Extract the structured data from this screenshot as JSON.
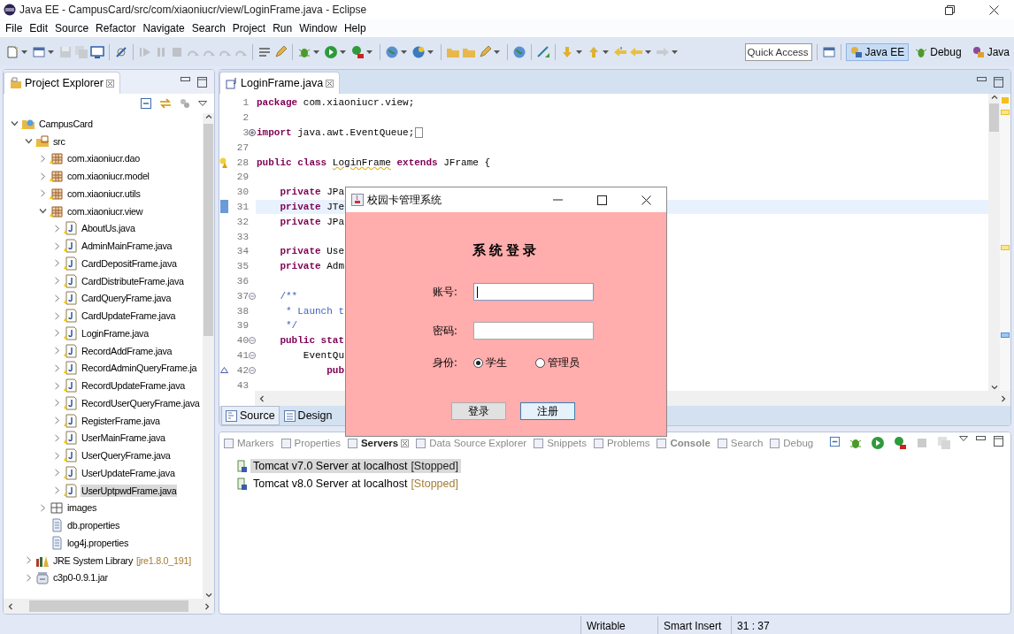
{
  "window": {
    "title": "Java EE - CampusCard/src/com/xiaoniucr/view/LoginFrame.java - Eclipse"
  },
  "menu": [
    "File",
    "Edit",
    "Source",
    "Refactor",
    "Navigate",
    "Search",
    "Project",
    "Run",
    "Window",
    "Help"
  ],
  "quick_access": {
    "placeholder": "Quick Access"
  },
  "perspectives": [
    {
      "label": "Java EE",
      "selected": true
    },
    {
      "label": "Debug",
      "selected": false
    },
    {
      "label": "Java",
      "selected": false
    }
  ],
  "explorer": {
    "title": "Project Explorer",
    "tree": [
      {
        "label": "CampusCard",
        "kind": "project",
        "expanded": true,
        "selected": false,
        "children": [
          {
            "label": "src",
            "kind": "source-folder",
            "expanded": true,
            "selected": false,
            "children": [
              {
                "label": "com.xiaoniucr.dao",
                "kind": "package",
                "expanded": false,
                "selected": false
              },
              {
                "label": "com.xiaoniucr.model",
                "kind": "package",
                "expanded": false,
                "selected": false
              },
              {
                "label": "com.xiaoniucr.utils",
                "kind": "package",
                "expanded": false,
                "selected": false
              },
              {
                "label": "com.xiaoniucr.view",
                "kind": "package",
                "expanded": true,
                "selected": false,
                "children": [
                  {
                    "label": "AboutUs.java",
                    "kind": "java-file",
                    "expanded": false,
                    "selected": false
                  },
                  {
                    "label": "AdminMainFrame.java",
                    "kind": "java-file",
                    "expanded": false,
                    "selected": false
                  },
                  {
                    "label": "CardDepositFrame.java",
                    "kind": "java-file",
                    "expanded": false,
                    "selected": false
                  },
                  {
                    "label": "CardDistributeFrame.java",
                    "kind": "java-file",
                    "expanded": false,
                    "selected": false
                  },
                  {
                    "label": "CardQueryFrame.java",
                    "kind": "java-file",
                    "expanded": false,
                    "selected": false
                  },
                  {
                    "label": "CardUpdateFrame.java",
                    "kind": "java-file",
                    "expanded": false,
                    "selected": false
                  },
                  {
                    "label": "LoginFrame.java",
                    "kind": "java-file",
                    "expanded": false,
                    "selected": false
                  },
                  {
                    "label": "RecordAddFrame.java",
                    "kind": "java-file",
                    "expanded": false,
                    "selected": false
                  },
                  {
                    "label": "RecordAdminQueryFrame.ja",
                    "kind": "java-file",
                    "expanded": false,
                    "selected": false
                  },
                  {
                    "label": "RecordUpdateFrame.java",
                    "kind": "java-file",
                    "expanded": false,
                    "selected": false
                  },
                  {
                    "label": "RecordUserQueryFrame.java",
                    "kind": "java-file",
                    "expanded": false,
                    "selected": false
                  },
                  {
                    "label": "RegisterFrame.java",
                    "kind": "java-file",
                    "expanded": false,
                    "selected": false
                  },
                  {
                    "label": "UserMainFrame.java",
                    "kind": "java-file",
                    "expanded": false,
                    "selected": false
                  },
                  {
                    "label": "UserQueryFrame.java",
                    "kind": "java-file",
                    "expanded": false,
                    "selected": false
                  },
                  {
                    "label": "UserUpdateFrame.java",
                    "kind": "java-file",
                    "expanded": false,
                    "selected": false
                  },
                  {
                    "label": "UserUptpwdFrame.java",
                    "kind": "java-file",
                    "expanded": false,
                    "selected": true
                  }
                ]
              },
              {
                "label": "images",
                "kind": "folder",
                "expanded": false,
                "selected": false
              },
              {
                "label": "db.properties",
                "kind": "file",
                "selected": false
              },
              {
                "label": "log4j.properties",
                "kind": "file",
                "selected": false
              }
            ]
          },
          {
            "label": "JRE System Library",
            "decoration": "[jre1.8.0_191]",
            "kind": "library",
            "expanded": false,
            "selected": false
          },
          {
            "label": "c3p0-0.9.1.jar",
            "kind": "jar",
            "expanded": false,
            "selected": false
          }
        ]
      }
    ]
  },
  "editor": {
    "tabs": [
      {
        "label": "LoginFrame.java",
        "selected": true
      }
    ],
    "lines": [
      {
        "number": "1",
        "segments": [
          {
            "text": "package",
            "kind": "kw"
          },
          {
            "text": " com.xiaoniucr.view;",
            "kind": "plain"
          }
        ]
      },
      {
        "number": "2"
      },
      {
        "number": "3",
        "foldable": true,
        "collapsed": true,
        "segments": [
          {
            "text": "import",
            "kind": "kw"
          },
          {
            "text": " java.awt.EventQueue;",
            "kind": "plain"
          }
        ]
      },
      {
        "number": "27"
      },
      {
        "number": "28",
        "warning": true,
        "segments": [
          {
            "text": "public class ",
            "kind": "kw"
          },
          {
            "text": "LoginFrame",
            "kind": "warn"
          },
          {
            "text": " extends",
            "kind": "kw"
          },
          {
            "text": " JFrame {",
            "kind": "plain"
          }
        ]
      },
      {
        "number": "29"
      },
      {
        "number": "30",
        "segments": [
          {
            "text": "    private",
            "kind": "kw"
          },
          {
            "text": " JPa",
            "kind": "plain"
          }
        ]
      },
      {
        "number": "31",
        "current": true,
        "occurrence": true,
        "segments": [
          {
            "text": "    private",
            "kind": "kw"
          },
          {
            "text": " JTe",
            "kind": "plain"
          }
        ]
      },
      {
        "number": "32",
        "segments": [
          {
            "text": "    private",
            "kind": "kw"
          },
          {
            "text": " JPa",
            "kind": "plain"
          }
        ]
      },
      {
        "number": "33"
      },
      {
        "number": "34",
        "segments": [
          {
            "text": "    private",
            "kind": "kw"
          },
          {
            "text": " Use",
            "kind": "plain"
          }
        ]
      },
      {
        "number": "35",
        "segments": [
          {
            "text": "    private",
            "kind": "kw"
          },
          {
            "text": " Adm",
            "kind": "plain"
          }
        ]
      },
      {
        "number": "36"
      },
      {
        "number": "37",
        "foldable": true,
        "collapsed": false,
        "segments": [
          {
            "text": "    /**",
            "kind": "doc"
          }
        ]
      },
      {
        "number": "38",
        "segments": [
          {
            "text": "     * Launch t",
            "kind": "doc"
          }
        ]
      },
      {
        "number": "39",
        "segments": [
          {
            "text": "     */",
            "kind": "doc"
          }
        ]
      },
      {
        "number": "40",
        "foldable": true,
        "collapsed": false,
        "segments": [
          {
            "text": "    public stat",
            "kind": "kw"
          }
        ]
      },
      {
        "number": "41",
        "foldable": true,
        "collapsed": false,
        "segments": [
          {
            "text": "        EventQu",
            "kind": "plain"
          }
        ]
      },
      {
        "number": "42",
        "foldable": true,
        "collapsed": false,
        "override": true,
        "segments": [
          {
            "text": "            pub",
            "kind": "kw"
          }
        ]
      },
      {
        "number": "43"
      }
    ],
    "view_tabs": [
      {
        "label": "Source",
        "selected": true
      },
      {
        "label": "Design",
        "selected": false
      }
    ]
  },
  "bottom_panel": {
    "tabs": [
      {
        "label": "Markers",
        "selected": false
      },
      {
        "label": "Properties",
        "selected": false
      },
      {
        "label": "Servers",
        "selected": true
      },
      {
        "label": "Data Source Explorer",
        "selected": false
      },
      {
        "label": "Snippets",
        "selected": false
      },
      {
        "label": "Problems",
        "selected": false
      },
      {
        "label": "Console",
        "selected": false,
        "bold": true
      },
      {
        "label": "Search",
        "selected": false
      },
      {
        "label": "Debug",
        "selected": false
      }
    ],
    "servers": [
      {
        "name": "Tomcat v7.0 Server at localhost",
        "status": "[Stopped]",
        "selected": true
      },
      {
        "name": "Tomcat v8.0 Server at localhost",
        "status": "[Stopped]",
        "selected": false
      }
    ]
  },
  "status_bar": [
    "Writable",
    "Smart Insert",
    "31 : 37"
  ],
  "dialog": {
    "title": "校园卡管理系统",
    "heading": "系统登录",
    "fields": [
      {
        "label": "账号:",
        "focused": true
      },
      {
        "label": "密码:",
        "focused": false
      }
    ],
    "role": {
      "label": "身份:",
      "options": [
        {
          "label": "学生",
          "selected": true
        },
        {
          "label": "管理员",
          "selected": false
        }
      ]
    },
    "buttons": [
      {
        "label": "登录",
        "focused": false
      },
      {
        "label": "注册",
        "focused": true
      }
    ]
  }
}
